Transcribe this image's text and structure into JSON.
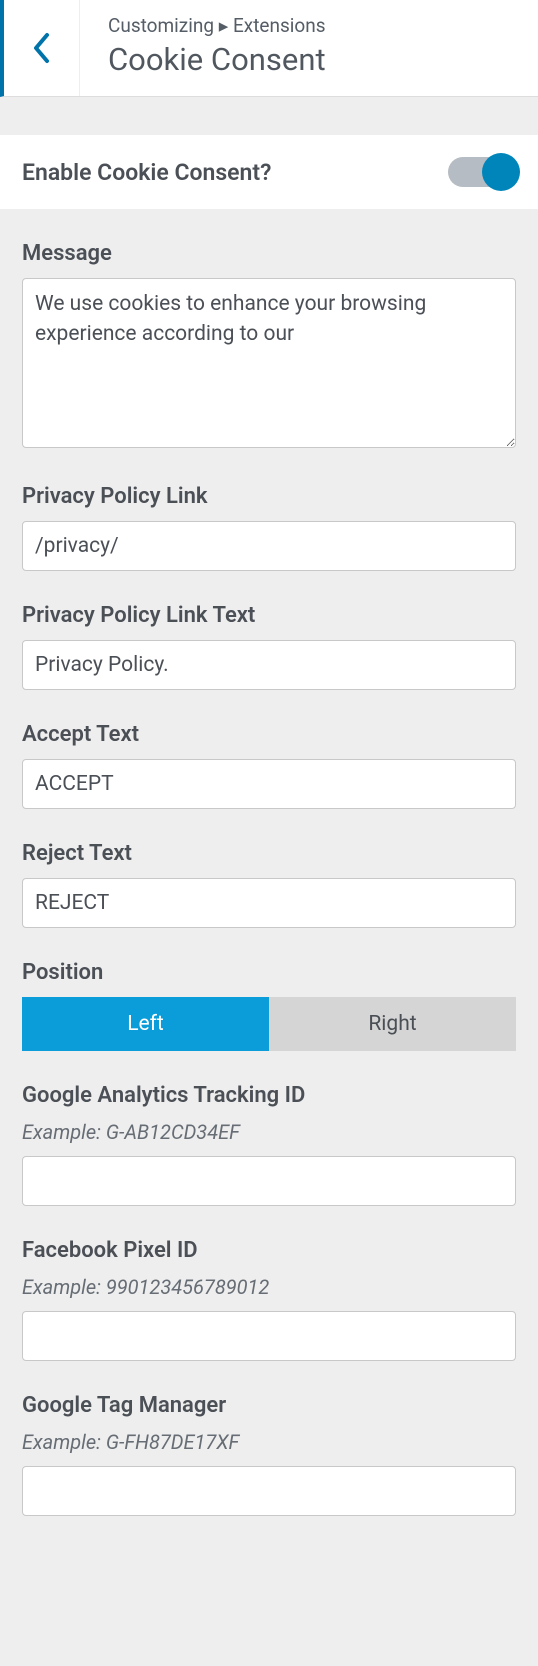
{
  "header": {
    "breadcrumb_prefix": "Customizing",
    "breadcrumb_section": "Extensions",
    "title": "Cookie Consent"
  },
  "enable": {
    "label": "Enable Cookie Consent?",
    "on": true
  },
  "fields": {
    "message": {
      "label": "Message",
      "value": "We use cookies to enhance your browsing experience according to our"
    },
    "privacy_link": {
      "label": "Privacy Policy Link",
      "value": "/privacy/"
    },
    "privacy_link_text": {
      "label": "Privacy Policy Link Text",
      "value": "Privacy Policy."
    },
    "accept_text": {
      "label": "Accept Text",
      "value": "ACCEPT"
    },
    "reject_text": {
      "label": "Reject Text",
      "value": "REJECT"
    },
    "position": {
      "label": "Position",
      "options": {
        "left": "Left",
        "right": "Right"
      },
      "selected": "left"
    },
    "ga_id": {
      "label": "Google Analytics Tracking ID",
      "example": "Example: G-AB12CD34EF",
      "value": ""
    },
    "fb_pixel": {
      "label": "Facebook Pixel ID",
      "example": "Example: 990123456789012",
      "value": ""
    },
    "gtm": {
      "label": "Google Tag Manager",
      "example": "Example: G-FH87DE17XF",
      "value": ""
    }
  }
}
